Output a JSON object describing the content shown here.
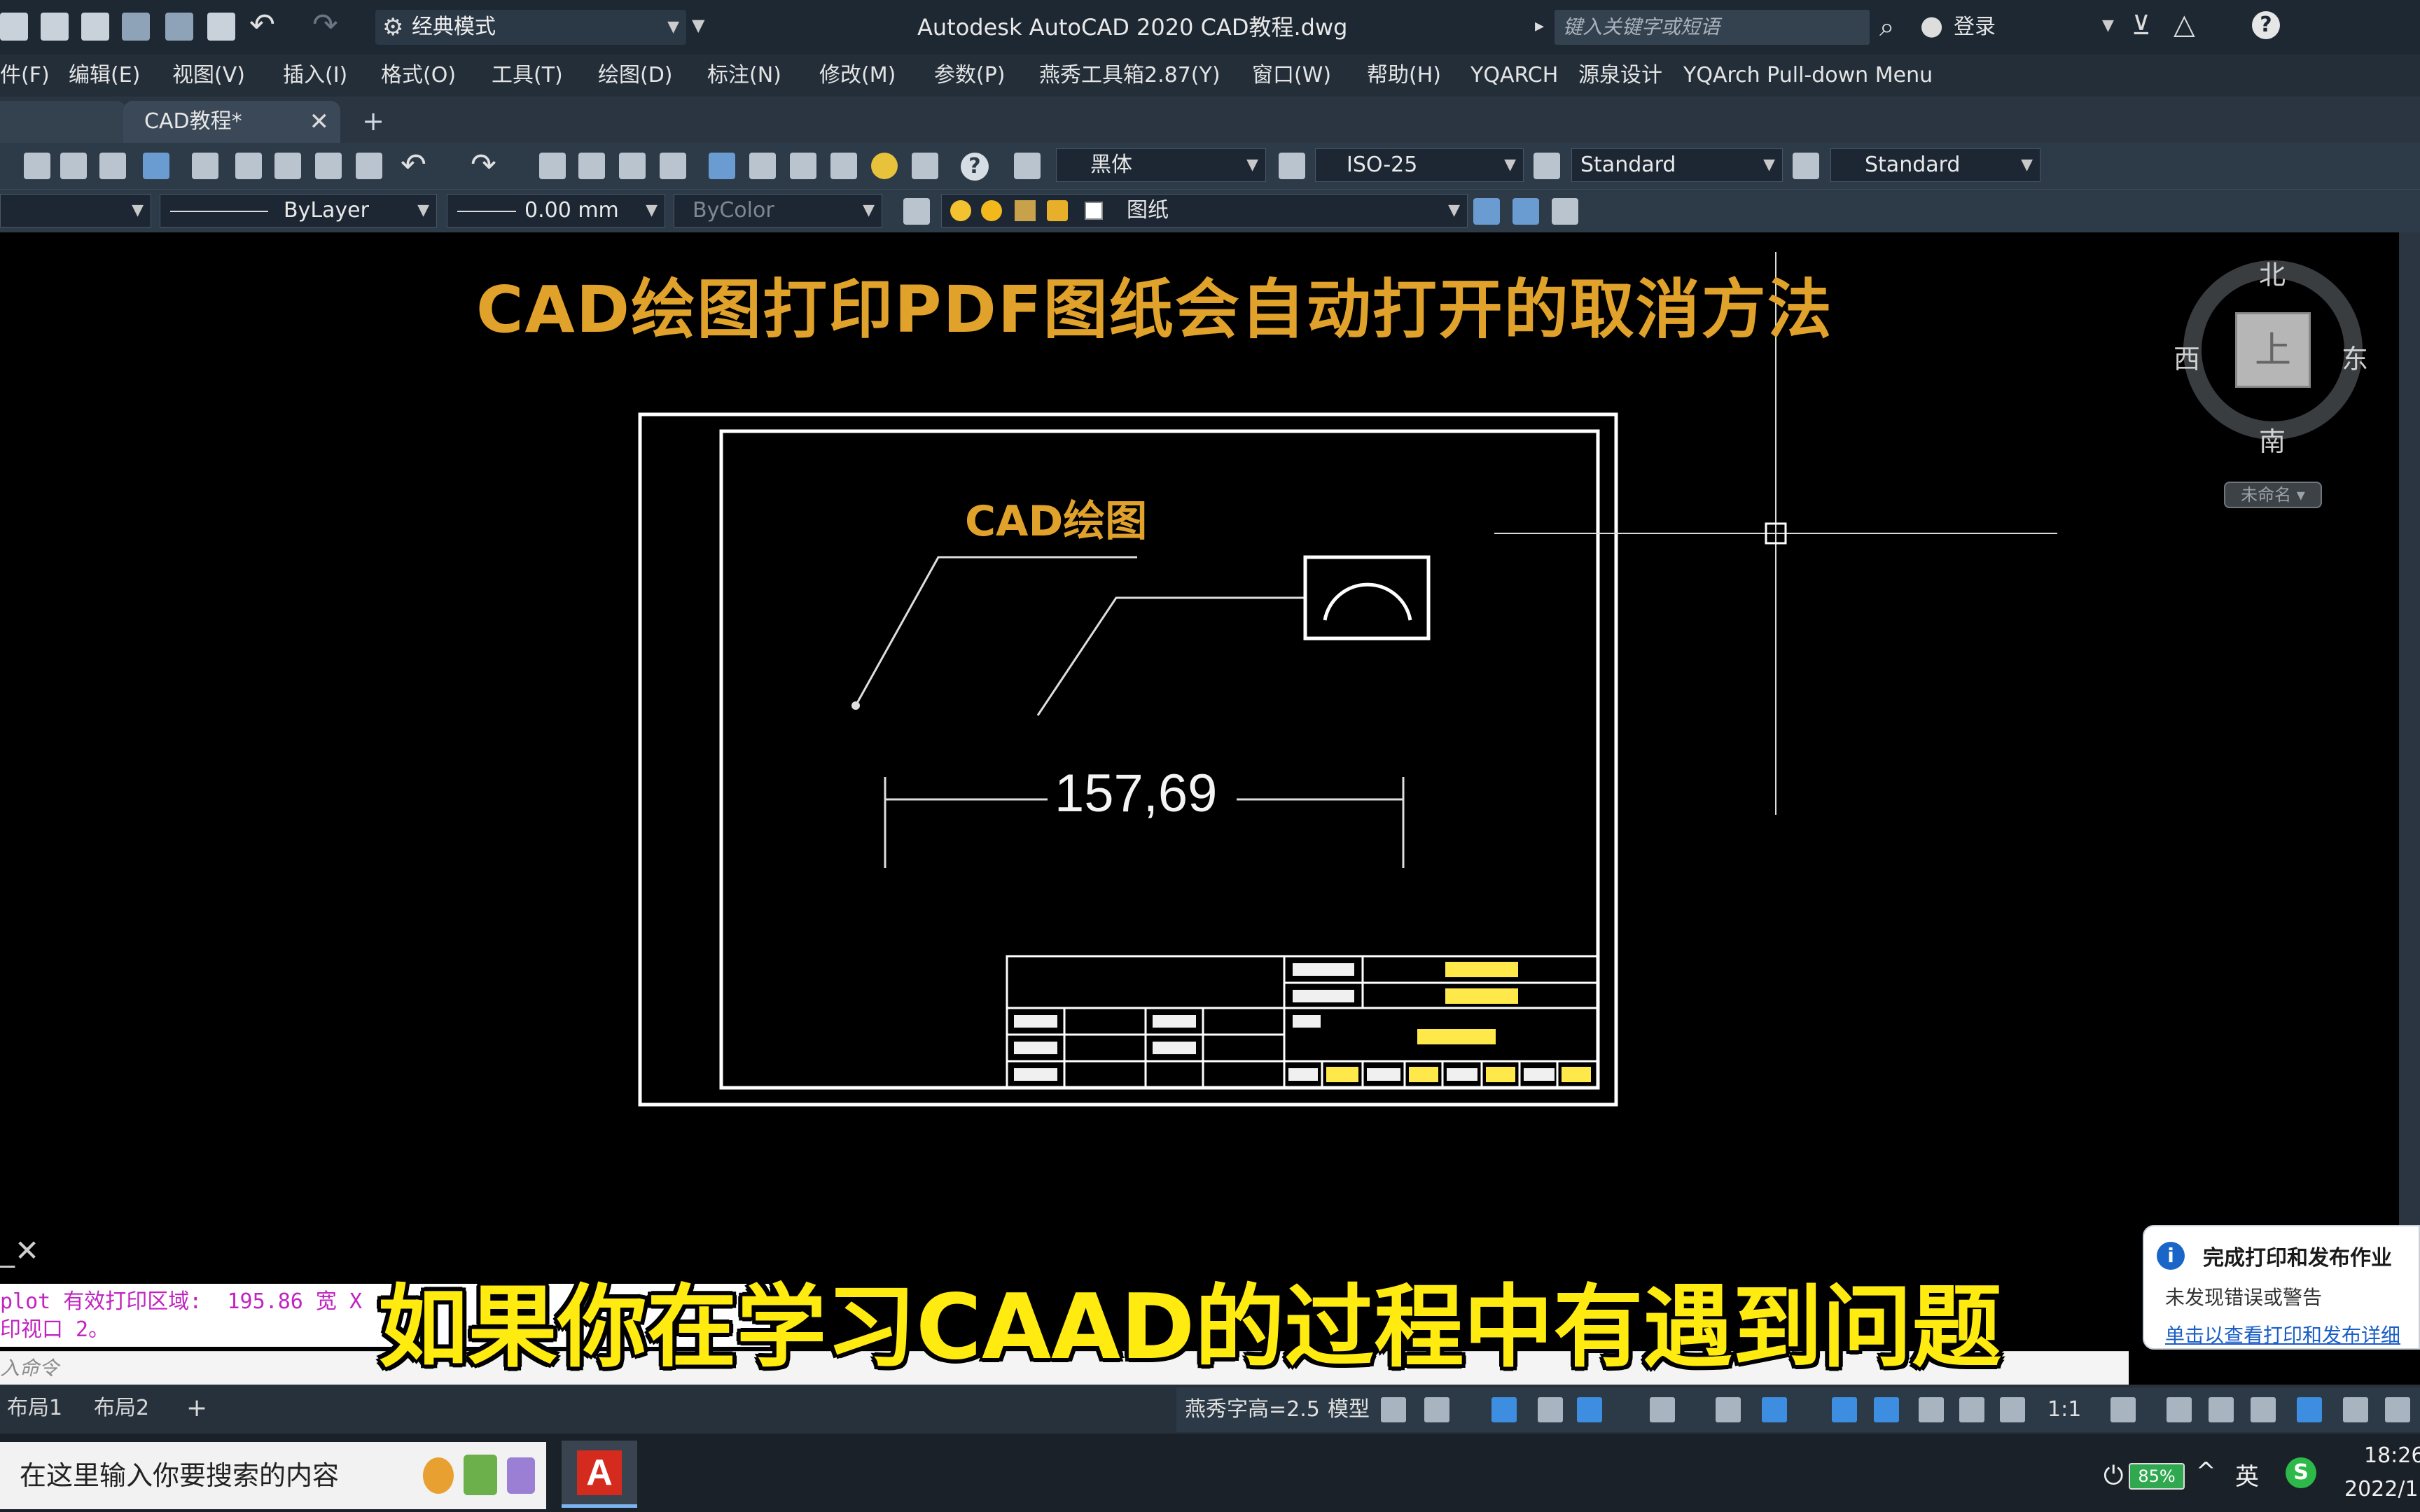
{
  "title_bar": {
    "workspace": "经典模式",
    "app_title": "Autodesk AutoCAD 2020    CAD教程.dwg",
    "search_placeholder": "键入关键字或短语",
    "login": "登录"
  },
  "menu": {
    "items": [
      "件(F)",
      "编辑(E)",
      "视图(V)",
      "插入(I)",
      "格式(O)",
      "工具(T)",
      "绘图(D)",
      "标注(N)",
      "修改(M)",
      "参数(P)",
      "燕秀工具箱2.87(Y)",
      "窗口(W)",
      "帮助(H)",
      "YQARCH",
      "源泉设计",
      "YQArch Pull-down Menu"
    ]
  },
  "tabs": {
    "active": "CAD教程*"
  },
  "toolbar": {
    "text_style": "黑体",
    "dim_style": "ISO-25",
    "table_style": "Standard",
    "multileader_style": "Standard",
    "linetype": "ByLayer",
    "lineweight": "0.00 mm",
    "plot_style": "ByColor",
    "layer": "图纸"
  },
  "drawing": {
    "title": "CAD绘图打印PDF图纸会自动打开的取消方法",
    "leader_label": "CAD绘图",
    "dimension": "157,69"
  },
  "viewcube": {
    "north": "北",
    "south": "南",
    "east": "东",
    "west": "西",
    "top": "上",
    "wcs": "未命名"
  },
  "command": {
    "history_line1": "plot 有效打印区域:  195.86 宽 X",
    "history_line2": "印视口 2。",
    "input_placeholder": "入命令"
  },
  "subtitle": "如果你在学习CAAD的过程中有遇到问题",
  "notification": {
    "title": "完成打印和发布作业",
    "body": "未发现错误或警告",
    "link": "单击以查看打印和发布详细"
  },
  "layout_tabs": [
    "布局1",
    "布局2"
  ],
  "status": {
    "font_height": "燕秀字高=2.5",
    "model": "模型",
    "scale": "1:1"
  },
  "taskbar": {
    "search_placeholder": "在这里输入你要搜索的内容",
    "battery": "85%",
    "ime": "英",
    "time": "18:26",
    "date": "2022/1"
  },
  "ime_indicator": "英"
}
